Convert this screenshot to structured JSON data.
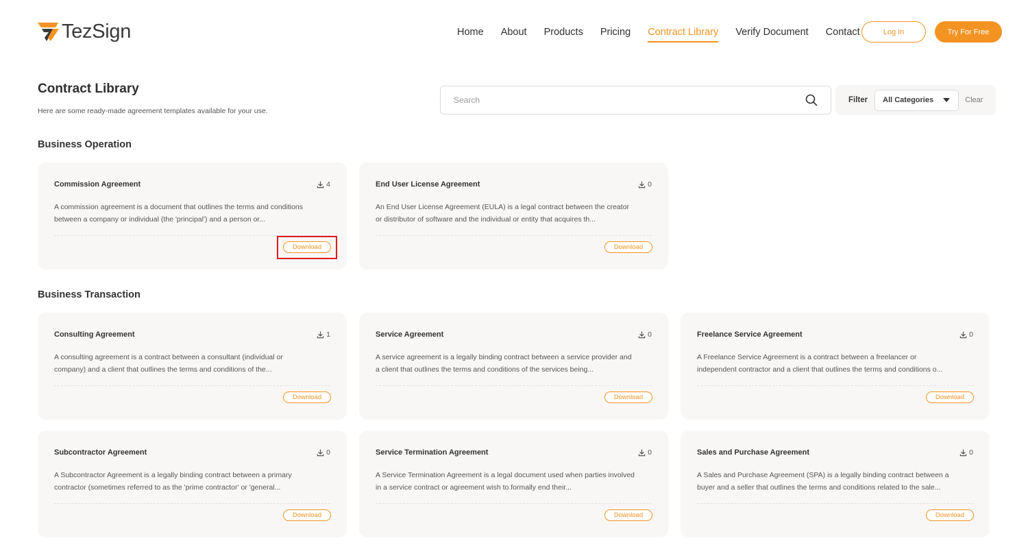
{
  "brand": {
    "name": "TezSign",
    "accent": "#f39322"
  },
  "nav": {
    "items": [
      "Home",
      "About",
      "Products",
      "Pricing",
      "Contract Library",
      "Verify Document",
      "Contact"
    ],
    "active": "Contract Library",
    "login": "Log In",
    "try": "Try For Free"
  },
  "page": {
    "title": "Contract Library",
    "subtitle": "Here are some ready-made agreement templates available for your use."
  },
  "search": {
    "placeholder": "Search",
    "value": ""
  },
  "filter": {
    "label": "Filter",
    "selected": "All Categories",
    "clear": "Clear"
  },
  "sections": [
    {
      "title": "Business Operation",
      "cards": [
        {
          "title": "Commission Agreement",
          "downloads": "4",
          "description": "A commission agreement is a document that outlines the terms and conditions between a company or individual (the 'principal') and a person or...",
          "button": "Download"
        },
        {
          "title": "End User License Agreement",
          "downloads": "0",
          "description": "An End User License Agreement (EULA) is a legal contract between the creator or distributor of software and the individual or entity that acquires th...",
          "button": "Download"
        }
      ]
    },
    {
      "title": "Business Transaction",
      "cards": [
        {
          "title": "Consulting Agreement",
          "downloads": "1",
          "description": "A consulting agreement is a contract between a consultant (individual or company) and a client that outlines the terms and conditions of the...",
          "button": "Download"
        },
        {
          "title": "Service Agreement",
          "downloads": "0",
          "description": "A service agreement is a legally binding contract between a service provider and a client that outlines the terms and conditions of the services being...",
          "button": "Download"
        },
        {
          "title": "Freelance Service Agreement",
          "downloads": "0",
          "description": "A Freelance Service Agreement is a contract between a freelancer or independent contractor and a client that outlines the terms and conditions o...",
          "button": "Download"
        },
        {
          "title": "Subcontractor Agreement",
          "downloads": "0",
          "description": "A Subcontractor Agreement is a legally binding contract between a primary contractor (sometimes referred to as the 'prime contractor' or 'general...",
          "button": "Download"
        },
        {
          "title": "Service Termination Agreement",
          "downloads": "0",
          "description": "A Service Termination Agreement is a legal document used when parties involved in a service contract or agreement wish to formally end their...",
          "button": "Download"
        },
        {
          "title": "Sales and Purchase Agreement",
          "downloads": "0",
          "description": "A Sales and Purchase Agreement (SPA) is a legally binding contract between a buyer and a seller that outlines the terms and conditions related to the sale...",
          "button": "Download"
        }
      ]
    }
  ]
}
